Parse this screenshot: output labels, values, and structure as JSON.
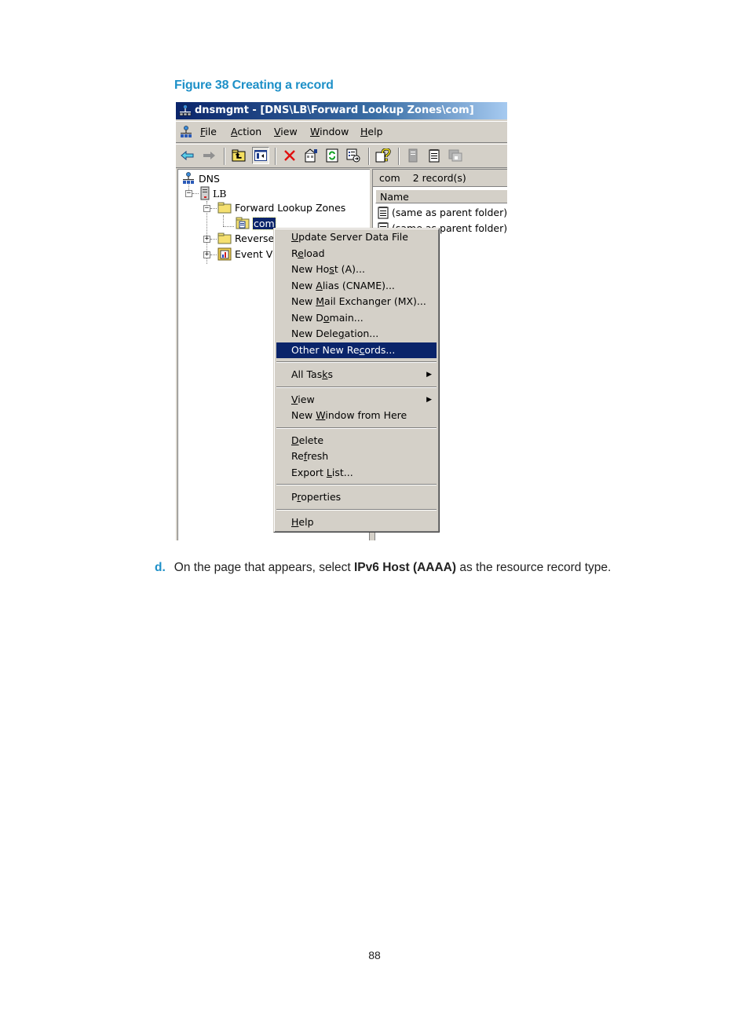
{
  "figure": {
    "caption": "Figure 38 Creating a record"
  },
  "window": {
    "title": "dnsmgmt - [DNS\\LB\\Forward Lookup Zones\\com]",
    "menu": [
      {
        "label": "File",
        "underline": "F",
        "rest": "ile"
      },
      {
        "label": "Action",
        "underline": "A",
        "rest": "ction"
      },
      {
        "label": "View",
        "underline": "V",
        "rest": "iew"
      },
      {
        "label": "Window",
        "underline": "W",
        "rest": "indow"
      },
      {
        "label": "Help",
        "underline": "H",
        "rest": "elp"
      }
    ],
    "toolbar": [
      {
        "icon": "back-arrow-icon"
      },
      {
        "icon": "forward-arrow-icon"
      },
      {
        "icon": "up-folder-icon"
      },
      {
        "icon": "show-hide-console-tree-icon"
      },
      {
        "icon": "delete-icon"
      },
      {
        "icon": "properties-icon"
      },
      {
        "icon": "refresh-icon"
      },
      {
        "icon": "export-list-icon"
      },
      {
        "icon": "help-icon"
      },
      {
        "icon": "server-icon"
      },
      {
        "icon": "notepad-icon"
      },
      {
        "icon": "window-icon"
      }
    ],
    "tree": {
      "root": "DNS",
      "server": "LB",
      "forward_zones": "Forward Lookup Zones",
      "selected_zone": "com",
      "reverse_zones": "Reverse",
      "event_viewer": "Event Vi"
    },
    "list": {
      "header_name": "com",
      "header_count": "2 record(s)",
      "column_name": "Name",
      "rows": [
        "(same as parent folder)",
        "(same as parent folder)"
      ],
      "row2_visible": "parent folder)"
    },
    "context_menu": {
      "groups": [
        [
          {
            "pre": "",
            "u": "U",
            "post": "pdate Server Data File"
          },
          {
            "pre": "R",
            "u": "e",
            "post": "load"
          },
          {
            "pre": "New Ho",
            "u": "s",
            "post": "t (A)..."
          },
          {
            "pre": "New ",
            "u": "A",
            "post": "lias (CNAME)..."
          },
          {
            "pre": "New ",
            "u": "M",
            "post": "ail Exchanger (MX)..."
          },
          {
            "pre": "New D",
            "u": "o",
            "post": "main..."
          },
          {
            "pre": "New Dele",
            "u": "g",
            "post": "ation..."
          },
          {
            "pre": "Other New Re",
            "u": "c",
            "post": "ords...",
            "highlighted": true
          }
        ],
        [
          {
            "pre": "All Tas",
            "u": "k",
            "post": "s",
            "submenu": true
          }
        ],
        [
          {
            "pre": "",
            "u": "V",
            "post": "iew",
            "submenu": true
          },
          {
            "pre": "New ",
            "u": "W",
            "post": "indow from Here"
          }
        ],
        [
          {
            "pre": "",
            "u": "D",
            "post": "elete"
          },
          {
            "pre": "Re",
            "u": "f",
            "post": "resh"
          },
          {
            "pre": "Export ",
            "u": "L",
            "post": "ist..."
          }
        ],
        [
          {
            "pre": "P",
            "u": "r",
            "post": "operties"
          }
        ],
        [
          {
            "pre": "",
            "u": "H",
            "post": "elp"
          }
        ]
      ]
    }
  },
  "step": {
    "marker": "d.",
    "text_before": "On the page that appears, select ",
    "bold": "IPv6 Host (AAAA)",
    "text_after": " as the resource record type."
  },
  "page_number": "88",
  "colors": {
    "caption_blue": "#1e90c8",
    "title_bar": "#0a246a",
    "menu_bg": "#d4d0c8",
    "highlight": "#0a246a"
  }
}
